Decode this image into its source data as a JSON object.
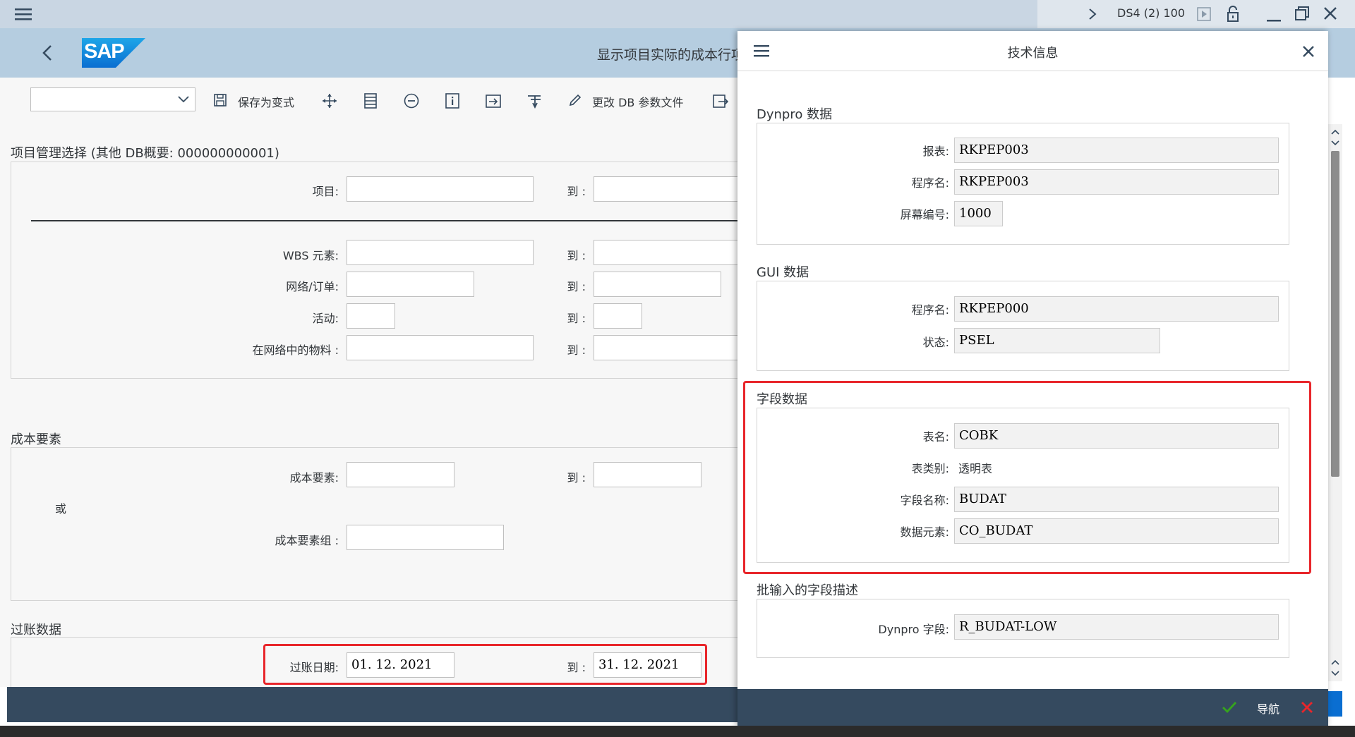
{
  "titlebar": {
    "session": "DS4 (2) 100"
  },
  "header": {
    "logo": "SAP",
    "title": "显示项目实际的成本行项"
  },
  "toolbar": {
    "save_variant": "保存为变式",
    "change_db": "更改 DB 参数文件"
  },
  "selection": {
    "section1_title": "项目管理选择 (其他 DB概要: 000000000001)",
    "project_label": "项目:",
    "to_label": "到 :",
    "wbs_label": "WBS 元素:",
    "network_label": "网络/订单:",
    "activity_label": "活动:",
    "material_label": "在网络中的物料 :",
    "section2_title": "成本要素",
    "cost_element_label": "成本要素:",
    "or_label": "或",
    "cost_element_group_label": "成本要素组 :",
    "section3_title": "过账数据",
    "posting_date_label": "过账日期:",
    "posting_date_from": "01. 12. 2021",
    "posting_date_to": "31. 12. 2021"
  },
  "dialog": {
    "title": "技术信息",
    "dynpro_section": "Dynpro 数据",
    "report_label": "报表:",
    "report_value": "RKPEP003",
    "program_label": "程序名:",
    "program_value": "RKPEP003",
    "screen_label": "屏幕编号:",
    "screen_value": "1000",
    "gui_section": "GUI 数据",
    "gui_program_label": "程序名:",
    "gui_program_value": "RKPEP000",
    "status_label": "状态:",
    "status_value": "PSEL",
    "field_section": "字段数据",
    "table_label": "表名:",
    "table_value": "COBK",
    "table_type_label": "表类别:",
    "table_type_value": "透明表",
    "field_label": "字段名称:",
    "field_value": "BUDAT",
    "data_element_label": "数据元素:",
    "data_element_value": "CO_BUDAT",
    "batch_section": "批输入的字段描述",
    "dynpro_field_label": "Dynpro 字段:",
    "dynpro_field_value": "R_BUDAT-LOW",
    "nav_label": "导航"
  },
  "colors": {
    "header_bg": "#b5cde0",
    "footer_bg": "#354a5f",
    "highlight": "#e8262b",
    "sap_blue": "#0a6ed1"
  }
}
